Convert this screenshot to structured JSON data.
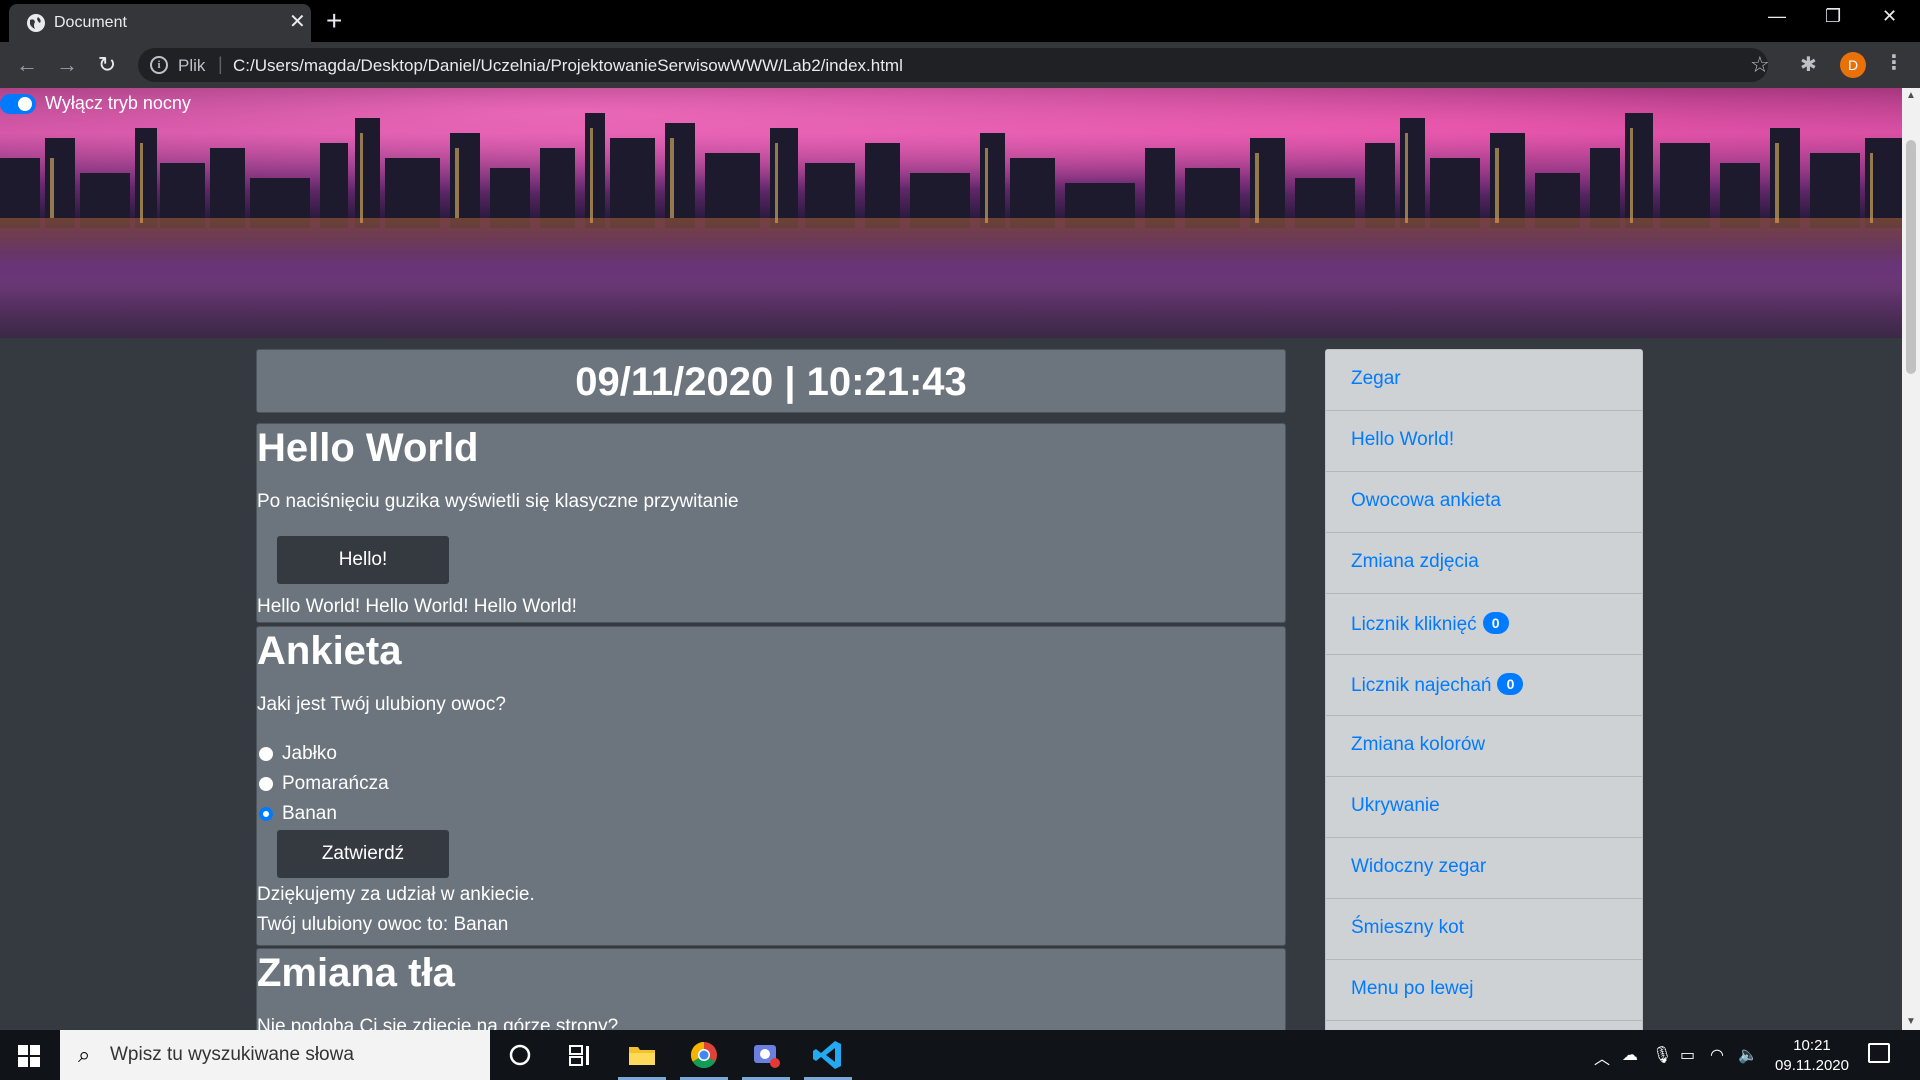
{
  "browser": {
    "tab_title": "Document",
    "tab_close": "✕",
    "new_tab": "+",
    "url_scheme": "Plik",
    "url": "C:/Users/magda/Desktop/Daniel/Uczelnia/ProjektowanieSerwisowWWW/Lab2/index.html",
    "profile_initial": "D",
    "window_controls": {
      "minimize": "—",
      "restore": "❐",
      "close": "✕"
    }
  },
  "page": {
    "night_mode_toggle": {
      "label": "Wyłącz tryb nocny",
      "on": true
    },
    "clock": "09/11/2020 | 10:21:43",
    "hello": {
      "title": "Hello World",
      "description": "Po naciśnięciu guzika wyświetli się klasyczne przywitanie",
      "button": "Hello!",
      "output": "Hello World! Hello World! Hello World!"
    },
    "survey": {
      "title": "Ankieta",
      "question": "Jaki jest Twój ulubiony owoc?",
      "options": [
        {
          "label": "Jabłko",
          "checked": false
        },
        {
          "label": "Pomarańcza",
          "checked": false
        },
        {
          "label": "Banan",
          "checked": true
        }
      ],
      "submit": "Zatwierdź",
      "thanks": "Dziękujemy za udział w ankiecie.",
      "result": "Twój ulubiony owoc to: Banan"
    },
    "background_change": {
      "title": "Zmiana tła",
      "text": "Nie podoba Ci się zdjęcie na górze strony?"
    },
    "sidebar": [
      {
        "label": "Zegar"
      },
      {
        "label": "Hello World!"
      },
      {
        "label": "Owocowa ankieta"
      },
      {
        "label": "Zmiana zdjęcia"
      },
      {
        "label": "Licznik kliknięć",
        "badge": "0"
      },
      {
        "label": "Licznik najechań",
        "badge": "0"
      },
      {
        "label": "Zmiana kolorów"
      },
      {
        "label": "Ukrywanie"
      },
      {
        "label": "Widoczny zegar"
      },
      {
        "label": "Śmieszny kot"
      },
      {
        "label": "Menu po lewej"
      }
    ]
  },
  "taskbar": {
    "search_placeholder": "Wpisz tu wyszukiwane słowa",
    "time": "10:21",
    "date": "09.11.2020",
    "accent": "#007bff"
  }
}
